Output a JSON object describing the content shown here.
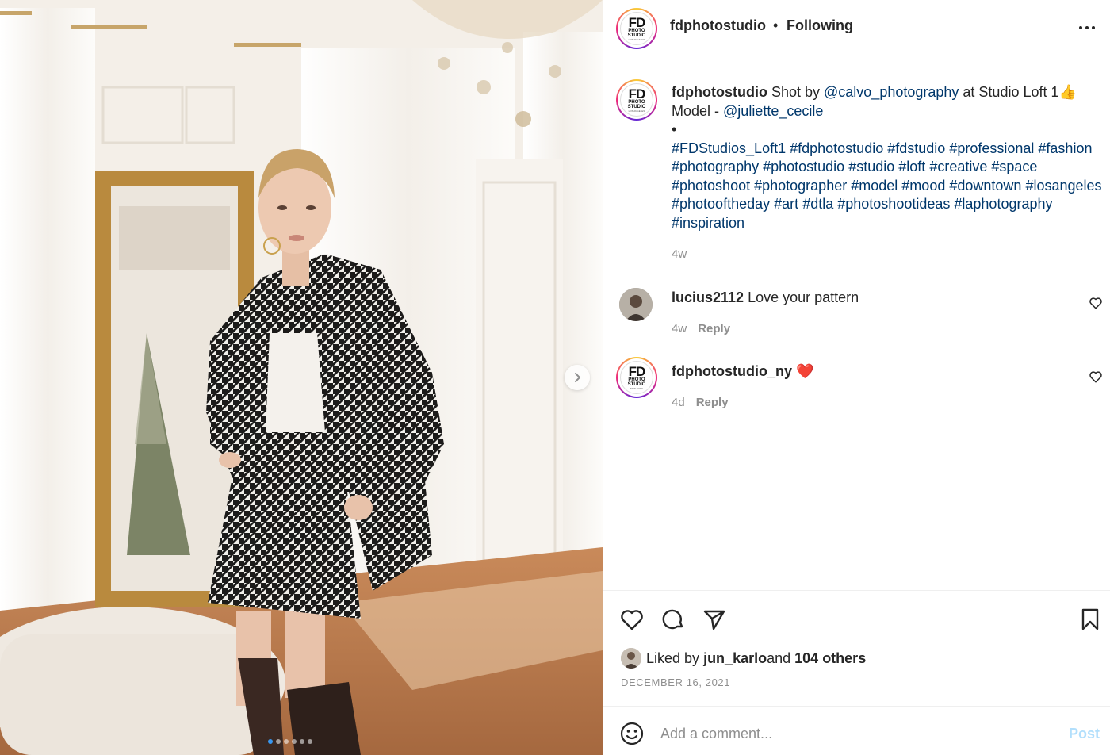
{
  "post": {
    "username": "fdphotostudio",
    "separator": "•",
    "follow_status": "Following",
    "avatar_logo": {
      "main": "FD",
      "sub1": "PHOTO",
      "sub2": "STUDIO",
      "loc_caption": "LOS ANGELES",
      "loc_reply": "NEW YORK"
    }
  },
  "media": {
    "carousel_count": 6,
    "carousel_active_index": 0
  },
  "caption": {
    "username": "fdphotostudio",
    "text_1": " Shot by ",
    "mention_1": "@calvo_photography",
    "text_2": " at Studio Loft 1👍",
    "line2_prefix": "Model - ",
    "mention_2": "@juliette_cecile",
    "bullet": "•",
    "hashtags": [
      "#FDStudios_Loft1",
      "#fdphotostudio",
      "#fdstudio",
      "#professional",
      "#fashion",
      "#photography",
      "#photostudio",
      "#studio",
      "#loft",
      "#creative",
      "#space",
      "#photoshoot",
      "#photographer",
      "#model",
      "#mood",
      "#downtown",
      "#losangeles",
      "#photooftheday",
      "#art",
      "#dtla",
      "#photoshootideas",
      "#laphotography",
      "#inspiration"
    ],
    "age": "4w"
  },
  "comments": [
    {
      "username": "lucius2112",
      "text": " Love your pattern",
      "age": "4w",
      "reply_label": "Reply"
    },
    {
      "username": "fdphotostudio_ny",
      "text": " ❤️",
      "age": "4d",
      "reply_label": "Reply"
    }
  ],
  "likes": {
    "prefix": "Liked by ",
    "user": "jun_karlo",
    "middle": " and ",
    "others": "104 others"
  },
  "date": "DECEMBER 16, 2021",
  "composer": {
    "placeholder": "Add a comment...",
    "post_label": "Post"
  },
  "colors": {
    "link": "#00376b",
    "muted": "#8e8e8e",
    "post_disabled": "#b2dffc",
    "carousel_active": "#3897f0"
  }
}
